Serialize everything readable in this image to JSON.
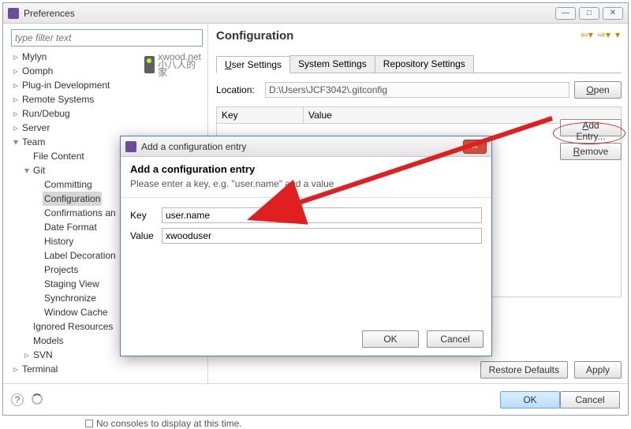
{
  "window": {
    "title": "Preferences",
    "min_tooltip": "minimize",
    "max_tooltip": "maximize",
    "close_tooltip": "close"
  },
  "filter": {
    "placeholder": "type filter text"
  },
  "watermark": {
    "line1": "xwood.net",
    "line2": "小八人的家"
  },
  "tree": {
    "items": [
      {
        "label": "Mylyn",
        "depth": 0,
        "expand": ">"
      },
      {
        "label": "Oomph",
        "depth": 0,
        "expand": ">"
      },
      {
        "label": "Plug-in Development",
        "depth": 0,
        "expand": ">"
      },
      {
        "label": "Remote Systems",
        "depth": 0,
        "expand": ">"
      },
      {
        "label": "Run/Debug",
        "depth": 0,
        "expand": ">"
      },
      {
        "label": "Server",
        "depth": 0,
        "expand": ">"
      },
      {
        "label": "Team",
        "depth": 0,
        "expand": "▾"
      },
      {
        "label": "File Content",
        "depth": 1,
        "expand": ""
      },
      {
        "label": "Git",
        "depth": 1,
        "expand": "▾"
      },
      {
        "label": "Committing",
        "depth": 2,
        "expand": ""
      },
      {
        "label": "Configuration",
        "depth": 2,
        "expand": "",
        "selected": true
      },
      {
        "label": "Confirmations an",
        "depth": 2,
        "expand": ""
      },
      {
        "label": "Date Format",
        "depth": 2,
        "expand": ""
      },
      {
        "label": "History",
        "depth": 2,
        "expand": ""
      },
      {
        "label": "Label Decoration",
        "depth": 2,
        "expand": ""
      },
      {
        "label": "Projects",
        "depth": 2,
        "expand": ""
      },
      {
        "label": "Staging View",
        "depth": 2,
        "expand": ""
      },
      {
        "label": "Synchronize",
        "depth": 2,
        "expand": ""
      },
      {
        "label": "Window Cache",
        "depth": 2,
        "expand": ""
      },
      {
        "label": "Ignored Resources",
        "depth": 1,
        "expand": ""
      },
      {
        "label": "Models",
        "depth": 1,
        "expand": ""
      },
      {
        "label": "SVN",
        "depth": 1,
        "expand": ">"
      },
      {
        "label": "Terminal",
        "depth": 0,
        "expand": ">"
      }
    ]
  },
  "panel": {
    "title": "Configuration",
    "tabs": {
      "user": "User Settings",
      "system": "System Settings",
      "repo": "Repository Settings"
    },
    "location_label": "Location:",
    "location_value": "D:\\Users\\JCF3042\\.gitconfig",
    "open": "Open",
    "key_header": "Key",
    "value_header": "Value",
    "add_entry": "Add Entry...",
    "remove": "Remove",
    "restore": "Restore Defaults",
    "apply": "Apply"
  },
  "footer": {
    "ok": "OK",
    "cancel": "Cancel"
  },
  "dialog": {
    "title": "Add a configuration entry",
    "heading": "Add a configuration entry",
    "hint": "Please enter a key, e.g. \"user.name\" and a value",
    "key_label": "Key",
    "value_label": "Value",
    "key_value": "user.name",
    "value_value": "xwooduser",
    "ok": "OK",
    "cancel": "Cancel"
  },
  "status": {
    "text": "No consoles to display at this time."
  }
}
